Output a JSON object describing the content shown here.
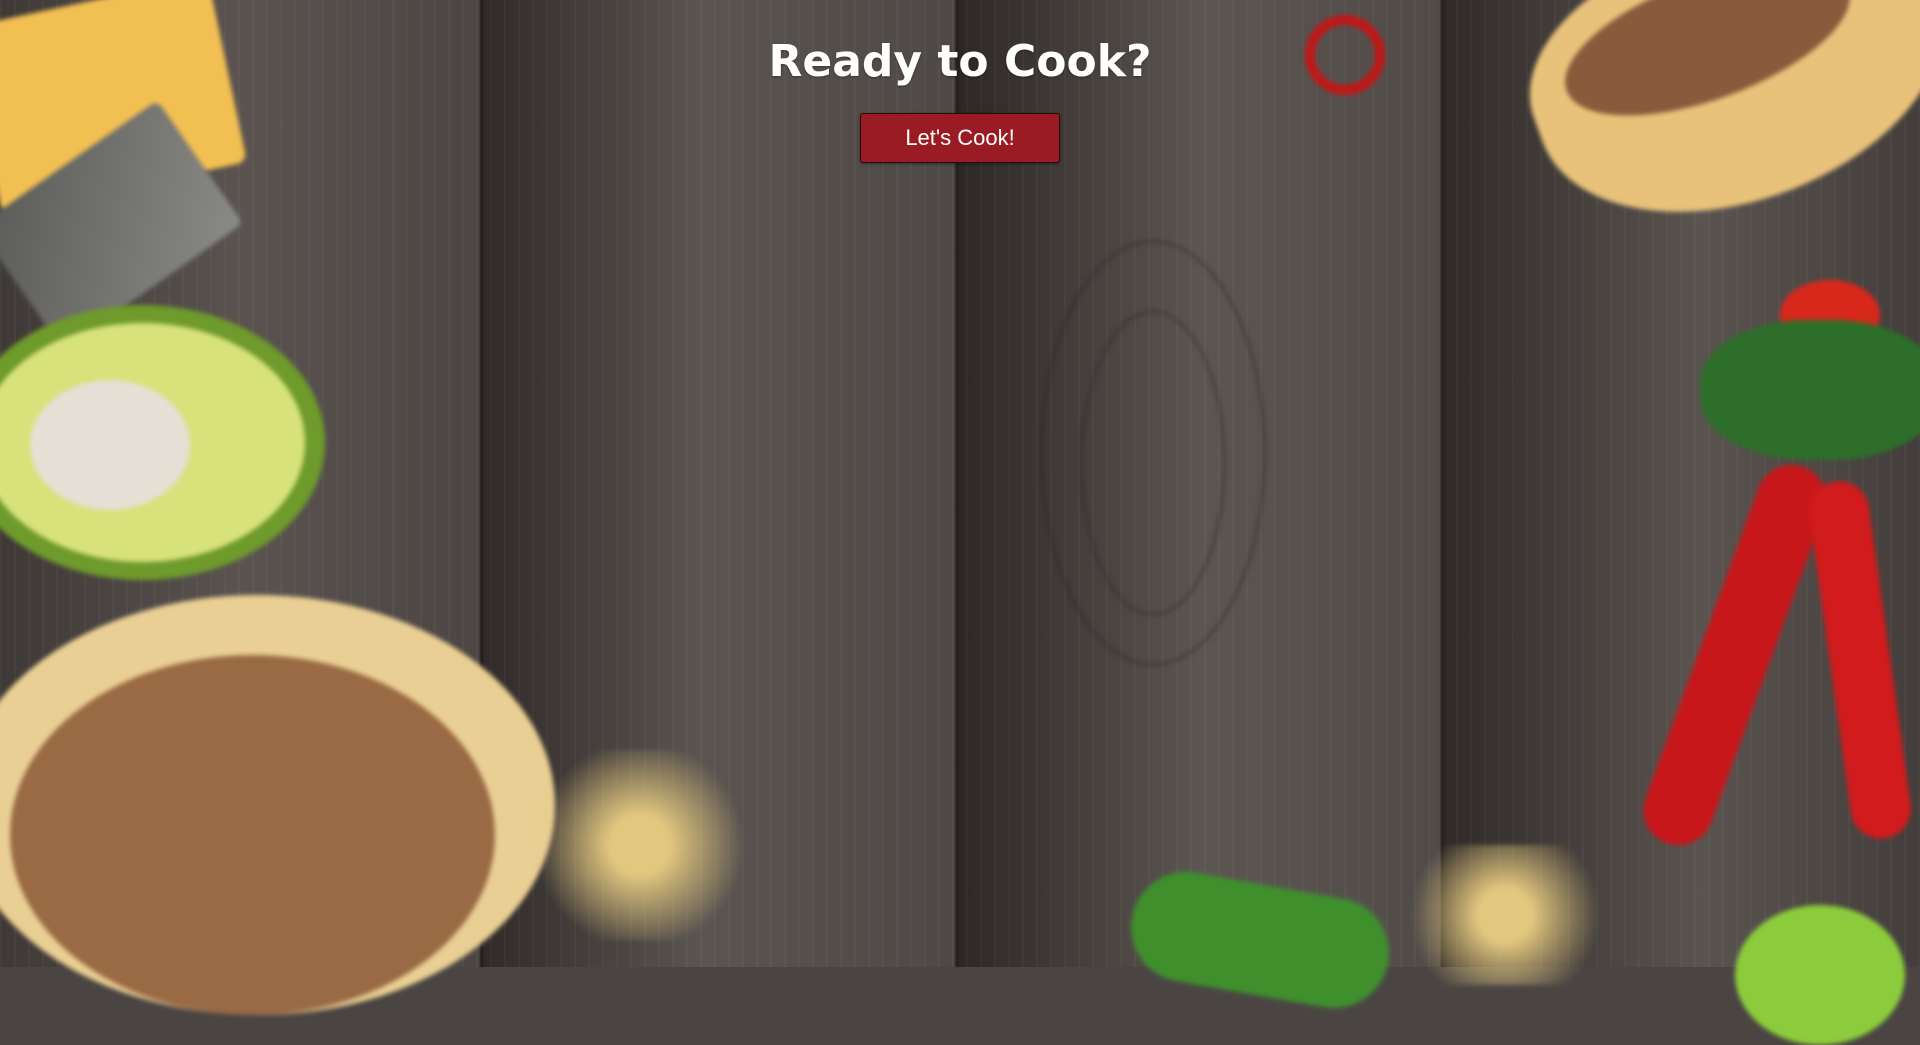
{
  "hero": {
    "title": "Ready to Cook?",
    "button_label": "Let's Cook!"
  },
  "colors": {
    "button_background": "#9b1b24",
    "title_text": "#ffffff",
    "wood_background": "#4a4543"
  },
  "background_decorations": [
    "cheese-block",
    "cheese-grater",
    "avocado-half",
    "taco-plate",
    "tacos",
    "red-chili-peppers",
    "cherry-tomato",
    "parsley",
    "jalapeno-pepper",
    "lime",
    "shredded-cheese"
  ]
}
